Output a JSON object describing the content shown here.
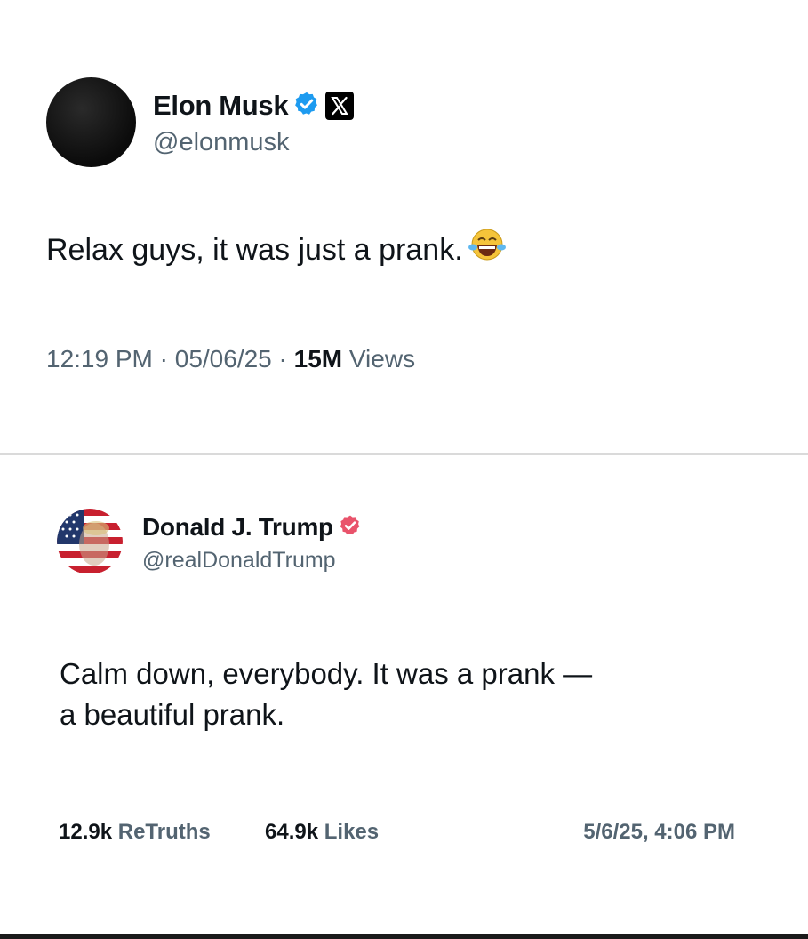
{
  "x_post": {
    "author_name": "Elon Musk",
    "handle": "@elonmusk",
    "text": "Relax guys, it was just a prank.",
    "emoji": "face-with-tears-of-joy",
    "time": "12:19 PM",
    "separator": "·",
    "date": "05/06/25",
    "views_count": "15M",
    "views_label": "Views",
    "colors": {
      "verified": "#1d9bf0",
      "handle": "#536471"
    }
  },
  "truth_post": {
    "author_name": "Donald J. Trump",
    "handle": "@realDonaldTrump",
    "text_line1": "Calm down, everybody. It was a prank —",
    "text_line2": "a beautiful prank.",
    "retruths_count": "12.9k",
    "retruths_label": "ReTruths",
    "likes_count": "64.9k",
    "likes_label": "Likes",
    "timestamp": "5/6/25, 4:06 PM",
    "colors": {
      "verified": "#e9536b"
    }
  }
}
